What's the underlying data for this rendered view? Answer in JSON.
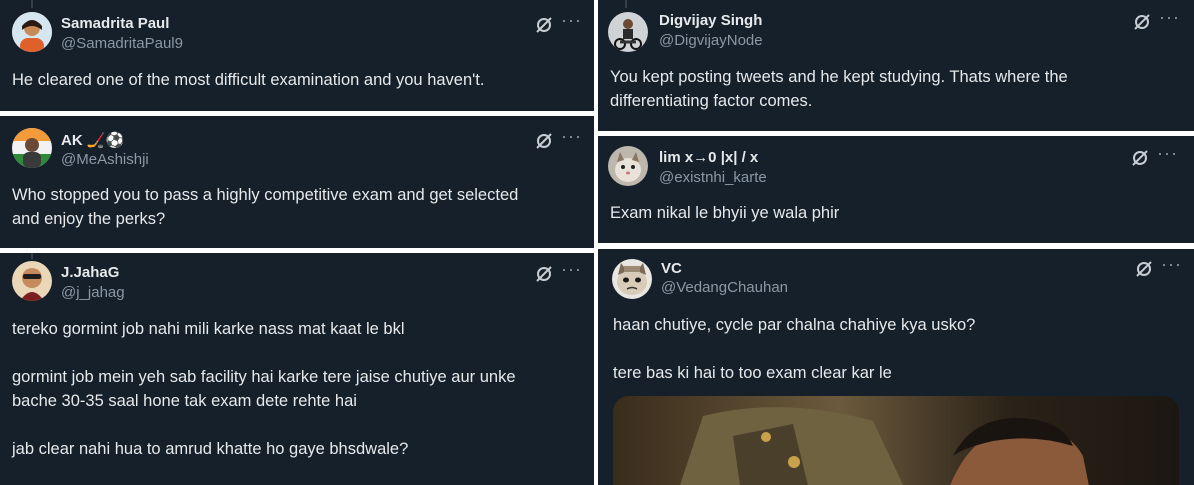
{
  "tweets": [
    {
      "name": "Samadrita Paul",
      "handle": "@SamadritaPaul9",
      "text": "He cleared one of the most difficult examination and you haven't."
    },
    {
      "name": "AK 🏒⚽",
      "handle": "@MeAshishji",
      "text": "Who stopped you to pass a highly competitive exam and get selected\nand enjoy the perks?"
    },
    {
      "name": "J.JahaG",
      "handle": "@j_jahag",
      "text": "tereko gormint job nahi mili karke nass mat kaat le bkl\n\ngormint job mein yeh sab facility hai karke tere jaise chutiye aur unke\nbache 30-35 saal hone tak exam dete rehte hai\n\njab clear nahi hua to amrud khatte ho gaye bhsdwale?"
    },
    {
      "name": "Digvijay Singh",
      "handle": "@DigvijayNode",
      "text": "You kept posting tweets and he kept studying. Thats where the\ndifferentiating factor comes."
    },
    {
      "name": "lim x→0 |x| / x",
      "handle": "@existnhi_karte",
      "text": "Exam nikal le bhyii ye wala phir"
    },
    {
      "name": "VC",
      "handle": "@VedangChauhan",
      "text": "haan chutiye, cycle par chalna chahiye kya usko?\n\ntere bas ki hai to too exam clear kar le"
    }
  ],
  "icons": {
    "grok": "grok-icon",
    "more": "more-icon"
  },
  "colors": {
    "card_bg": "#15202b",
    "text": "#e7e9ea",
    "muted": "#8b98a5"
  }
}
